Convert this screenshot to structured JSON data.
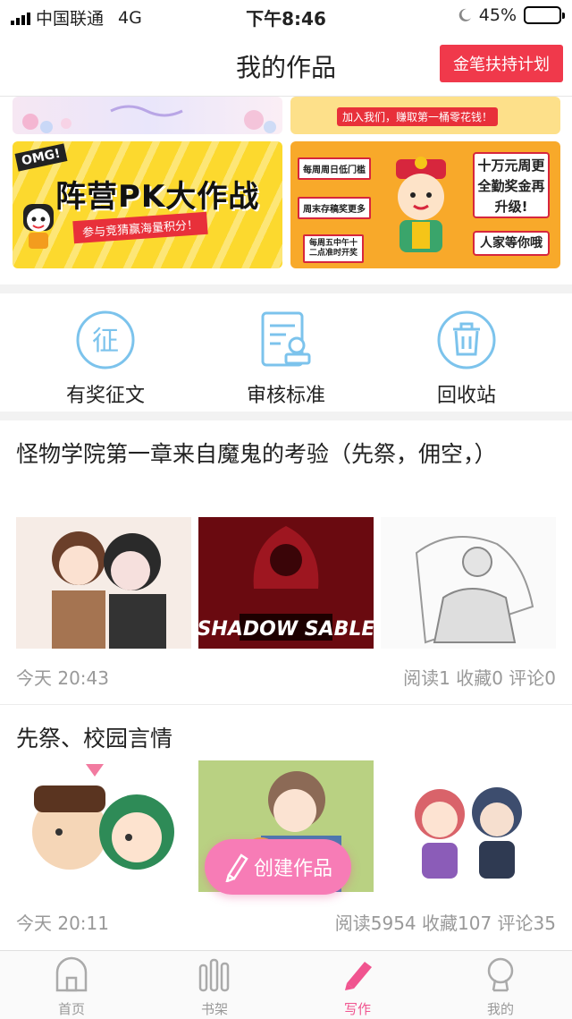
{
  "status_bar": {
    "carrier": "中国联通",
    "network": "4G",
    "time": "下午8:46",
    "battery": "45%",
    "battery_level": 0.45
  },
  "nav": {
    "title": "我的作品",
    "action_label": "金笔扶持计划"
  },
  "banners": {
    "top_right_text": "加入我们，赚取第一桶零花钱！",
    "pk": {
      "badge": "OMG!",
      "title": "阵营PK大作战",
      "subtitle": "参与竞猜赢海量积分！"
    },
    "weekly": {
      "tag1": "每周周日低门槛",
      "tag2": "周末存稿奖更多",
      "tag3": "每周五中午十二点准时开奖",
      "big_text": "十万元周更全勤奖金再升级!",
      "small_text": "人家等你哦"
    }
  },
  "shortcuts": [
    {
      "label": "有奖征文",
      "icon": "contest-icon",
      "glyph": "征"
    },
    {
      "label": "审核标准",
      "icon": "review-standard-icon"
    },
    {
      "label": "回收站",
      "icon": "trash-icon"
    }
  ],
  "works": [
    {
      "title": "怪物学院第一章来自魔鬼的考验（先祭，佣空，）",
      "time": "今天 20:43",
      "stats": "阅读1  收藏0  评论0",
      "thumb2_text": "SHADOW SABLE"
    },
    {
      "title": "先祭、校园言情",
      "time": "今天 20:11",
      "stats": "阅读5954  收藏107  评论35"
    }
  ],
  "fab": {
    "label": "创建作品"
  },
  "tabs": [
    {
      "label": "首页",
      "icon": "home-icon",
      "active": false
    },
    {
      "label": "书架",
      "icon": "bookshelf-icon",
      "active": false
    },
    {
      "label": "写作",
      "icon": "pen-icon",
      "active": true
    },
    {
      "label": "我的",
      "icon": "profile-icon",
      "active": false
    }
  ],
  "colors": {
    "accent": "#f0394b",
    "fab": "#f77cb6",
    "tab_active": "#f0548f",
    "shortcut_icon": "#7cc3ec"
  }
}
